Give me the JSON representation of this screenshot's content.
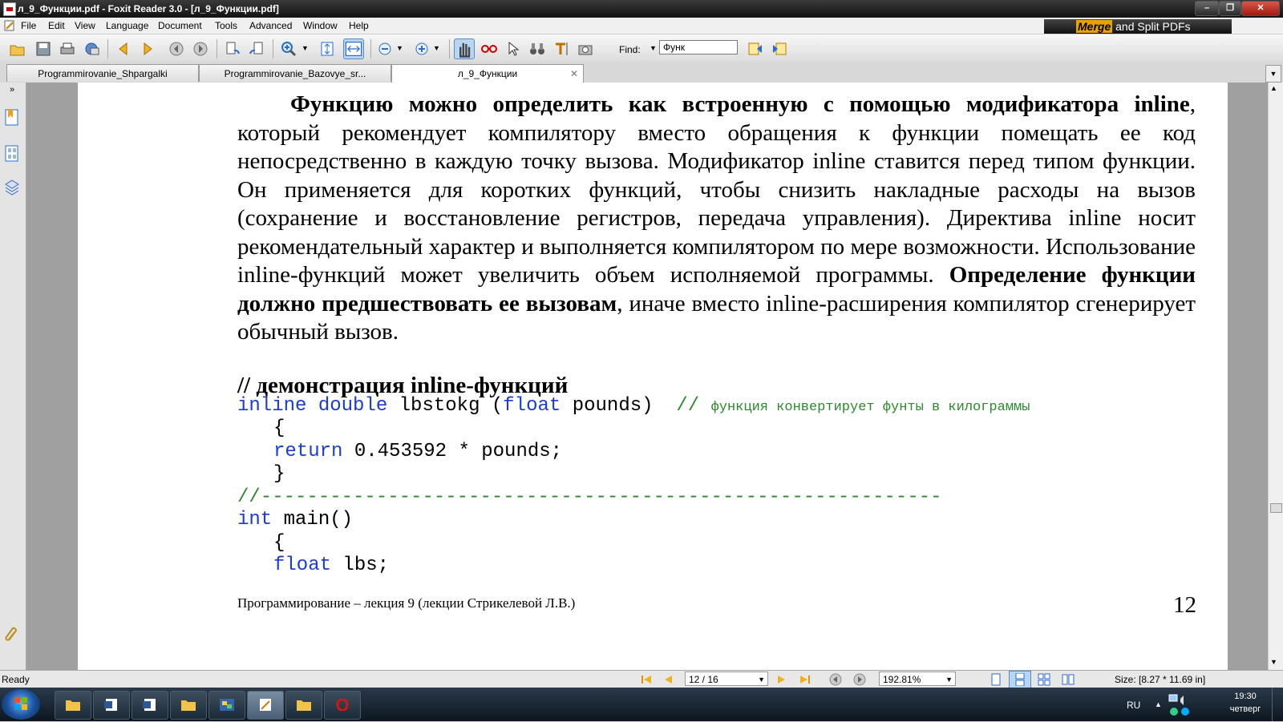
{
  "window": {
    "title": "л_9_Функции.pdf - Foxit Reader 3.0 - [л_9_Функции.pdf]"
  },
  "menu": [
    "File",
    "Edit",
    "View",
    "Language",
    "Document",
    "Tools",
    "Advanced",
    "Window",
    "Help"
  ],
  "banner": {
    "merge": "Merge",
    "rest": " and Split PDFs"
  },
  "toolbar": {
    "find_label": "Find:",
    "find_value": "Функ"
  },
  "tabs": [
    {
      "label": "Programmirovanie_Shpargalki"
    },
    {
      "label": "Programmirovanie_Bazovye_sr..."
    },
    {
      "label": "л_9_Функции",
      "close": "✕"
    }
  ],
  "document": {
    "para_bold_1": "Функцию можно определить как встроенную с помощью модификатора inline",
    "para_text_1": ", который рекомендует компилятору вместо обращения к функции помещать ее код непосредственно в каждую точку вызова. Модификатор inline ставится перед типом функции. Он применяется для коротких функций, чтобы снизить накладные расходы на вызов (сохранение и восстановление регистров, передача управления). Директива inline носит рекомендательный характер и выполняется компилятором по мере возможности. Использование inline-функций может увеличить объем исполняемой программы.",
    "para_bold_2": "Определение функции должно предшествовать ее вызовам",
    "para_text_2": ", иначе вместо inline-расширения компилятор сгенерирует обычный вызов.",
    "heading": "// демонстрация inline-функций",
    "code": {
      "l1_kw1": "inline",
      "l1_kw2": "double",
      "l1_txt1": "lbstokg (",
      "l1_kw3": "float",
      "l1_txt2": "pounds)",
      "l1_cm": "//",
      "l1_cm_text": "функция конвертирует фунты в килограммы",
      "l2": "{",
      "l3_kw": "return",
      "l3_txt": "0.453592 * pounds;",
      "l4": "}",
      "l5": "//-----------------------------------------------------------",
      "l6_kw": "int",
      "l6_txt": "main()",
      "l7": "{",
      "l8_kw": "float",
      "l8_txt": "lbs;"
    },
    "footer": "Программирование – лекция 9 (лекции Стрикелевой Л.В.)",
    "page_number": "12"
  },
  "status": {
    "ready": "Ready",
    "page": "12 / 16",
    "zoom": "192.81%",
    "size": "Size: [8.27 * 11.69 in]"
  },
  "taskbar": {
    "lang": "RU",
    "time": "19:30",
    "day": "четверг"
  }
}
